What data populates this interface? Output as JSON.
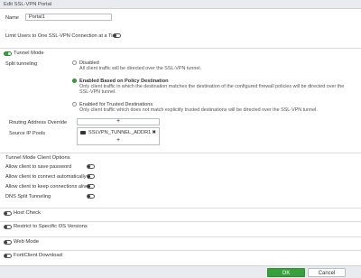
{
  "window": {
    "title": "Edit SSL-VPN Portal"
  },
  "form": {
    "name_label": "Name",
    "name_value": "Portal1",
    "limit_users_label": "Limit Users to One SSL-VPN Connection at a Time",
    "limit_users_enabled": false
  },
  "tunnel_mode": {
    "label": "Tunnel Mode",
    "enabled": true,
    "split_tunneling_label": "Split tunneling",
    "options": [
      {
        "title": "Disabled",
        "desc": "All client traffic will be directed over the SSL-VPN tunnel.",
        "selected": false
      },
      {
        "title": "Enabled Based on Policy Destination",
        "desc": "Only client traffic in which the destination matches the destination of the configured firewall policies will be directed over the SSL-VPN tunnel.",
        "selected": true
      },
      {
        "title": "Enabled for Trusted Destinations",
        "desc": "Only client traffic which does not match explicitly trusted destinations will be directed over the SSL-VPN tunnel.",
        "selected": false
      }
    ],
    "routing_override_label": "Routing Address Override",
    "add_symbol": "+",
    "source_ip_pools_label": "Source IP Pools",
    "source_ip_pool_item": "SSLVPN_TUNNEL_ADDR1",
    "remove_symbol": "✖"
  },
  "client_options": {
    "label": "Tunnel Mode Client Options",
    "items": [
      {
        "label": "Allow client to save password",
        "enabled": false
      },
      {
        "label": "Allow client to connect automatically",
        "enabled": false
      },
      {
        "label": "Allow client to keep connections alive",
        "enabled": false
      },
      {
        "label": "DNS Split Tunneling",
        "enabled": false
      }
    ]
  },
  "sections": [
    {
      "label": "Host Check",
      "enabled": false
    },
    {
      "label": "Restrict to Specific OS Versions",
      "enabled": false
    },
    {
      "label": "Web Mode",
      "enabled": false
    },
    {
      "label": "FortiClient Download",
      "enabled": false
    }
  ],
  "footer": {
    "ok_label": "OK",
    "cancel_label": "Cancel"
  },
  "colors": {
    "accent": "#37a03d",
    "header_bg": "#e9ebee"
  }
}
